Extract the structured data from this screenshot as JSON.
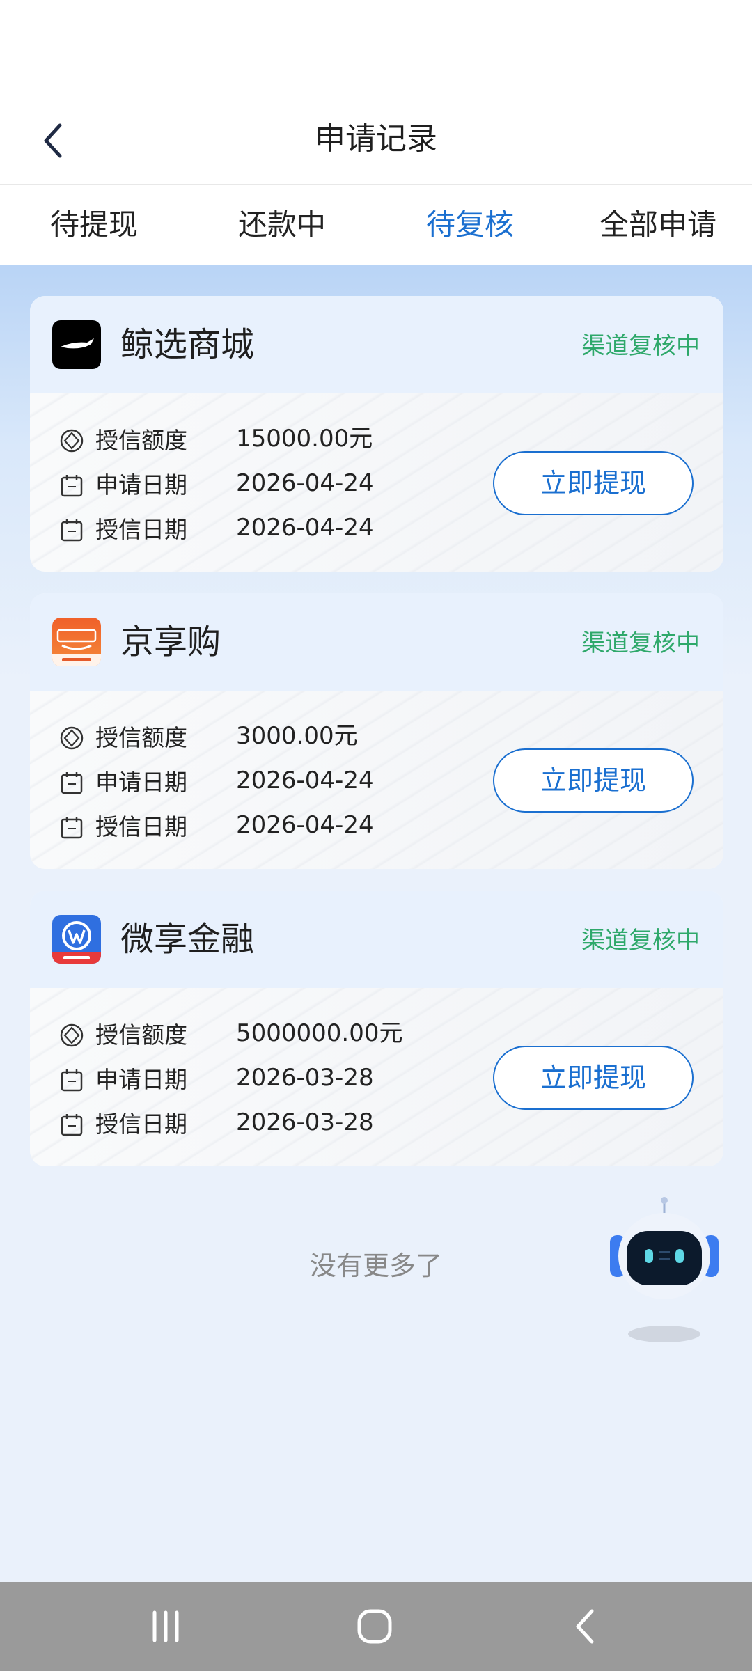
{
  "header": {
    "title": "申请记录"
  },
  "tabs": [
    {
      "label": "待提现",
      "active": false
    },
    {
      "label": "还款中",
      "active": false
    },
    {
      "label": "待复核",
      "active": true
    },
    {
      "label": "全部申请",
      "active": false
    }
  ],
  "labels": {
    "credit_amount": "授信额度",
    "apply_date": "申请日期",
    "credit_date": "授信日期"
  },
  "cards": [
    {
      "name": "鲸选商城",
      "logo": "whale-logo-icon",
      "status": "渠道复核中",
      "credit_amount": "15000.00元",
      "apply_date": "2026-04-24",
      "credit_date": "2026-04-24",
      "button": "立即提现"
    },
    {
      "name": "京享购",
      "logo": "jingxianggou-logo-icon",
      "status": "渠道复核中",
      "credit_amount": "3000.00元",
      "apply_date": "2026-04-24",
      "credit_date": "2026-04-24",
      "button": "立即提现"
    },
    {
      "name": "微享金融",
      "logo": "weixiang-logo-icon",
      "status": "渠道复核中",
      "credit_amount": "5000000.00元",
      "apply_date": "2026-03-28",
      "credit_date": "2026-03-28",
      "button": "立即提现"
    }
  ],
  "footer": {
    "no_more": "没有更多了"
  },
  "colors": {
    "accent": "#1a6fd0",
    "status_green": "#2ea86a"
  }
}
